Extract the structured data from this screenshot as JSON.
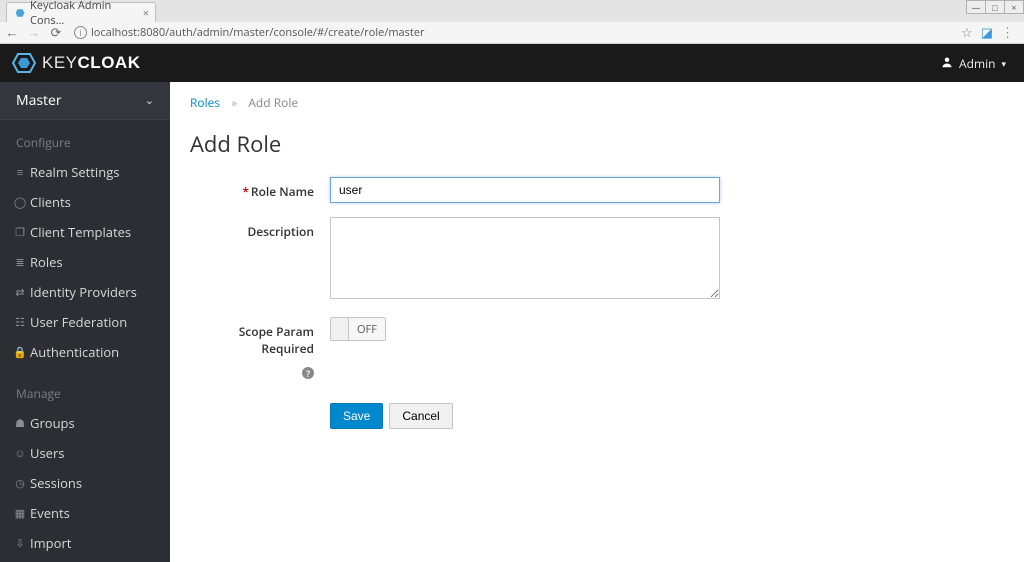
{
  "browser": {
    "tab_title": "Keycloak Admin Cons…",
    "url": "localhost:8080/auth/admin/master/console/#/create/role/master"
  },
  "header": {
    "brand_thin": "KEY",
    "brand_bold": "CLOAK",
    "user_label": "Admin"
  },
  "realm": {
    "name": "Master"
  },
  "sidebar": {
    "configure_label": "Configure",
    "manage_label": "Manage",
    "configure": [
      {
        "label": "Realm Settings"
      },
      {
        "label": "Clients"
      },
      {
        "label": "Client Templates"
      },
      {
        "label": "Roles"
      },
      {
        "label": "Identity Providers"
      },
      {
        "label": "User Federation"
      },
      {
        "label": "Authentication"
      }
    ],
    "manage": [
      {
        "label": "Groups"
      },
      {
        "label": "Users"
      },
      {
        "label": "Sessions"
      },
      {
        "label": "Events"
      },
      {
        "label": "Import"
      }
    ]
  },
  "breadcrumb": {
    "roles": "Roles",
    "current": "Add Role"
  },
  "page": {
    "title": "Add Role"
  },
  "form": {
    "role_name_label": "Role Name",
    "role_name_value": "user",
    "description_label": "Description",
    "description_value": "",
    "scope_label": "Scope Param Required",
    "toggle_state": "OFF",
    "save_label": "Save",
    "cancel_label": "Cancel"
  }
}
